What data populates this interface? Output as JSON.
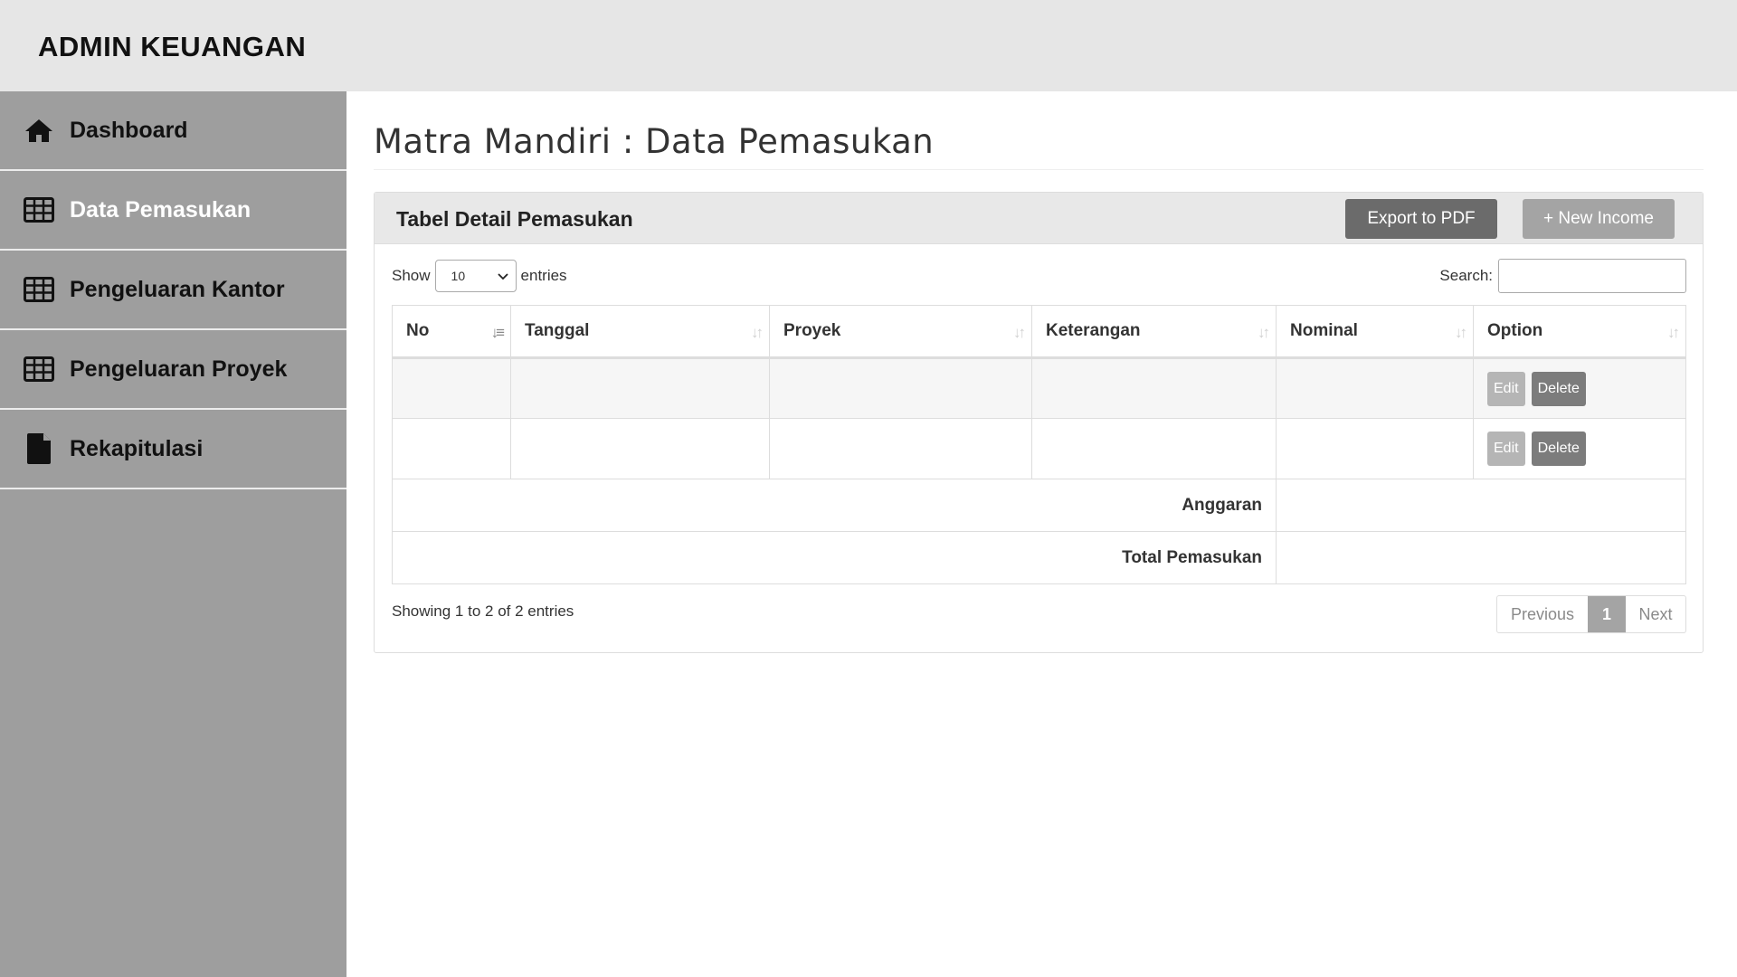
{
  "app": {
    "brand": "ADMIN KEUANGAN"
  },
  "sidebar": {
    "items": [
      {
        "label": "Dashboard",
        "icon": "home-icon",
        "active": false
      },
      {
        "label": "Data Pemasukan",
        "icon": "table-icon",
        "active": true
      },
      {
        "label": "Pengeluaran Kantor",
        "icon": "table-icon",
        "active": false
      },
      {
        "label": "Pengeluaran Proyek",
        "icon": "table-icon",
        "active": false
      },
      {
        "label": "Rekapitulasi",
        "icon": "file-icon",
        "active": false
      }
    ]
  },
  "main": {
    "page_title": "Matra Mandiri : Data Pemasukan",
    "panel": {
      "title": "Tabel Detail Pemasukan",
      "export_label": "Export to PDF",
      "new_label": "+ New Income"
    },
    "length": {
      "show_label": "Show",
      "value": "10",
      "entries_label": "entries"
    },
    "search": {
      "label": "Search:",
      "value": "",
      "placeholder": ""
    },
    "table": {
      "columns": [
        "No",
        "Tanggal",
        "Proyek",
        "Keterangan",
        "Nominal",
        "Option"
      ],
      "rows": [
        {
          "no": "",
          "tanggal": "",
          "proyek": "",
          "keterangan": "",
          "nominal": "",
          "edit": "Edit",
          "delete": "Delete"
        },
        {
          "no": "",
          "tanggal": "",
          "proyek": "",
          "keterangan": "",
          "nominal": "",
          "edit": "Edit",
          "delete": "Delete"
        }
      ],
      "footer": [
        {
          "label": "Anggaran",
          "value": ""
        },
        {
          "label": "Total Pemasukan",
          "value": ""
        }
      ]
    },
    "info": "Showing 1 to 2 of 2 entries",
    "pagination": {
      "previous": "Previous",
      "current": "1",
      "next": "Next"
    }
  },
  "colors": {
    "topbar": "#e6e6e6",
    "sidebar": "#9e9e9e",
    "export_button": "#6b6b6b",
    "new_button": "#a4a4a4"
  }
}
